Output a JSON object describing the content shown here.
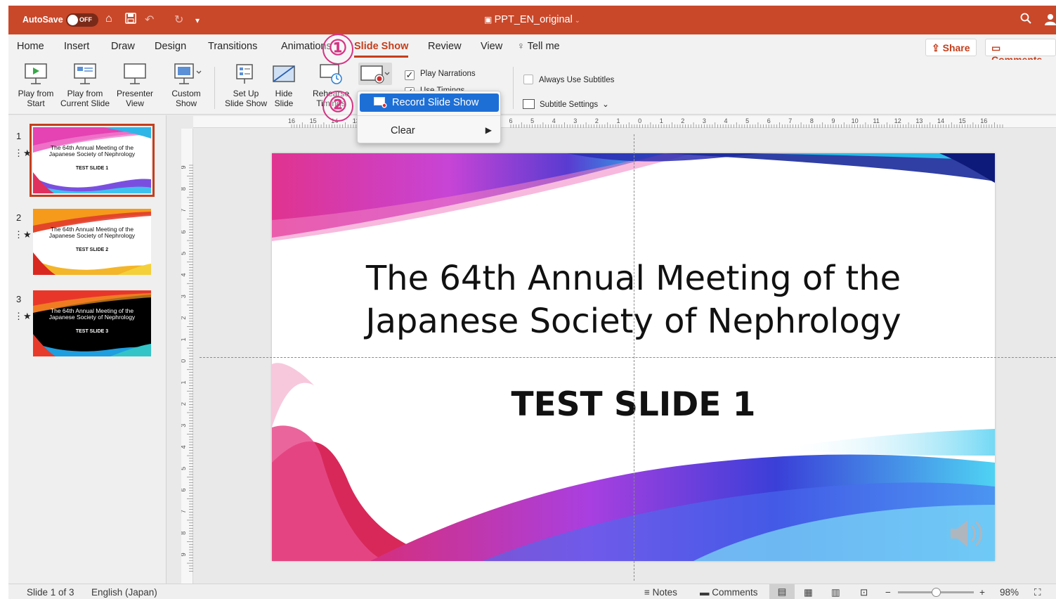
{
  "titlebar": {
    "autosave_label": "AutoSave",
    "toggle_state": "OFF",
    "doc_title": "PPT_EN_original",
    "accent": "#c9482a"
  },
  "menu": {
    "tabs": [
      "Home",
      "Insert",
      "Draw",
      "Design",
      "Transitions",
      "Animations",
      "Slide Show",
      "Review",
      "View"
    ],
    "active_tab": "Slide Show",
    "tell_me": "Tell me",
    "share": "Share",
    "comments": "Comments"
  },
  "ribbon": {
    "play_from_start": [
      "Play from",
      "Start"
    ],
    "play_from_current": [
      "Play from",
      "Current Slide"
    ],
    "presenter_view": [
      "Presenter",
      "View"
    ],
    "custom_show": [
      "Custom",
      "Show"
    ],
    "set_up": [
      "Set Up",
      "Slide Show"
    ],
    "hide_slide": [
      "Hide",
      "Slide"
    ],
    "rehearse": [
      "Rehearse",
      "Timings"
    ],
    "play_narrations": "Play Narrations",
    "use_timings": "Use Timings",
    "always_use_subtitles": "Always Use Subtitles",
    "subtitle_settings": "Subtitle Settings"
  },
  "dropdown": {
    "record": "Record Slide Show",
    "clear": "Clear"
  },
  "annotations": [
    "①",
    "②"
  ],
  "slides": [
    {
      "number": "1",
      "title": "The 64th Annual Meeting of the Japanese Society of Nephrology",
      "subtitle": "TEST SLIDE 1"
    },
    {
      "number": "2",
      "title": "The 64th Annual Meeting of the Japanese Society of Nephrology",
      "subtitle": "TEST SLIDE 2"
    },
    {
      "number": "3",
      "title": "The 64th Annual Meeting of the Japanese Society of Nephrology",
      "subtitle": "TEST SLIDE 3"
    }
  ],
  "main_slide": {
    "title_line1": "The 64th Annual Meeting of the",
    "title_line2": "Japanese Society of Nephrology",
    "subtitle": "TEST SLIDE 1"
  },
  "status": {
    "slide_position": "Slide 1 of 3",
    "language": "English (Japan)",
    "notes": "Notes",
    "comments": "Comments",
    "zoom": "98%"
  },
  "ruler_labels": [
    "16",
    "15",
    "14",
    "13",
    "6",
    "5",
    "4",
    "3",
    "2",
    "1",
    "0",
    "1",
    "2",
    "3",
    "4",
    "5",
    "6",
    "7",
    "8",
    "9",
    "10",
    "11",
    "12",
    "13",
    "14",
    "15",
    "16"
  ],
  "vruler_labels": [
    "9",
    "8",
    "7",
    "6",
    "5",
    "4",
    "3",
    "2",
    "1",
    "0",
    "1",
    "2",
    "3",
    "4",
    "5",
    "6",
    "7",
    "8",
    "9"
  ]
}
